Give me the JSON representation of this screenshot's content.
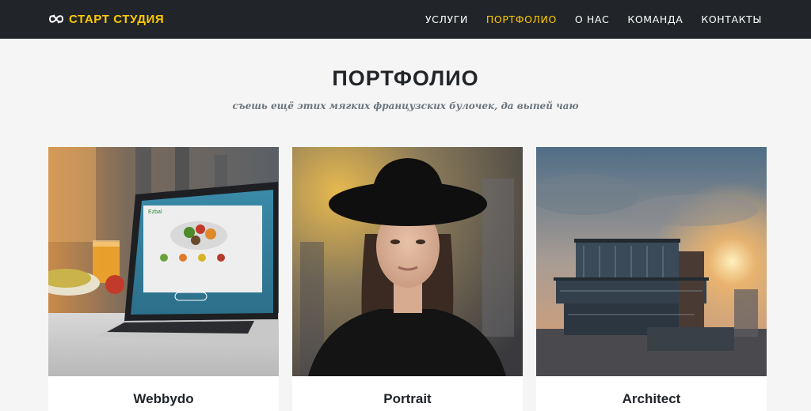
{
  "brand": {
    "name": "СТАРТ СТУДИЯ",
    "logo_icon": "infinity-logo-icon",
    "color": "#ffc800"
  },
  "nav": {
    "items": [
      {
        "label": "УСЛУГИ",
        "active": false
      },
      {
        "label": "ПОРТФОЛИО",
        "active": true
      },
      {
        "label": "О НАС",
        "active": false
      },
      {
        "label": "КОМАНДА",
        "active": false
      },
      {
        "label": "КОНТАКТЫ",
        "active": false
      }
    ]
  },
  "portfolio": {
    "heading": "ПОРТФОЛИО",
    "subheading": "съешь ещё этих мягких французских булочек, да выпей чаю",
    "items": [
      {
        "title": "Webbydo",
        "image": "laptop-on-table-photo",
        "screen_logo": "Ezbal"
      },
      {
        "title": "Portrait",
        "image": "woman-in-hat-portrait-photo"
      },
      {
        "title": "Architect",
        "image": "modern-building-sunset-photo"
      }
    ]
  },
  "colors": {
    "navbar_bg": "#212529",
    "accent": "#ffc800",
    "page_bg": "#f5f5f5",
    "text_dark": "#212529",
    "text_muted": "#6c757d"
  }
}
